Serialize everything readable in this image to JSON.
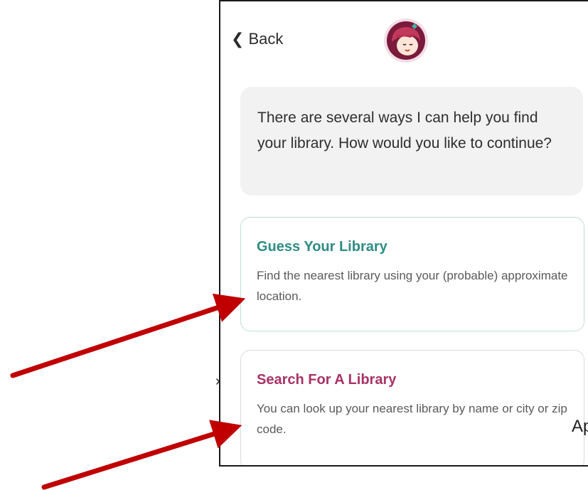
{
  "header": {
    "back_label": "Back",
    "avatar_icon": "reader-girl-avatar-icon"
  },
  "message": {
    "text": "There are several ways I can help you find your library. How would you like to continue?"
  },
  "options": [
    {
      "title": "Guess Your Library",
      "description": "Find the nearest library using your (probable) approximate location.",
      "accent": "#2e8c84"
    },
    {
      "title": "Search For A Library",
      "description": "You can look up your nearest library by name or city or zip code.",
      "accent": "#a83266"
    }
  ],
  "background_peek": {
    "left_glyph": "›",
    "right_text": "Ap"
  },
  "annotations": {
    "arrow_color": "#c00000",
    "arrows": [
      "arrow-to-guess-card",
      "arrow-to-search-card"
    ]
  }
}
